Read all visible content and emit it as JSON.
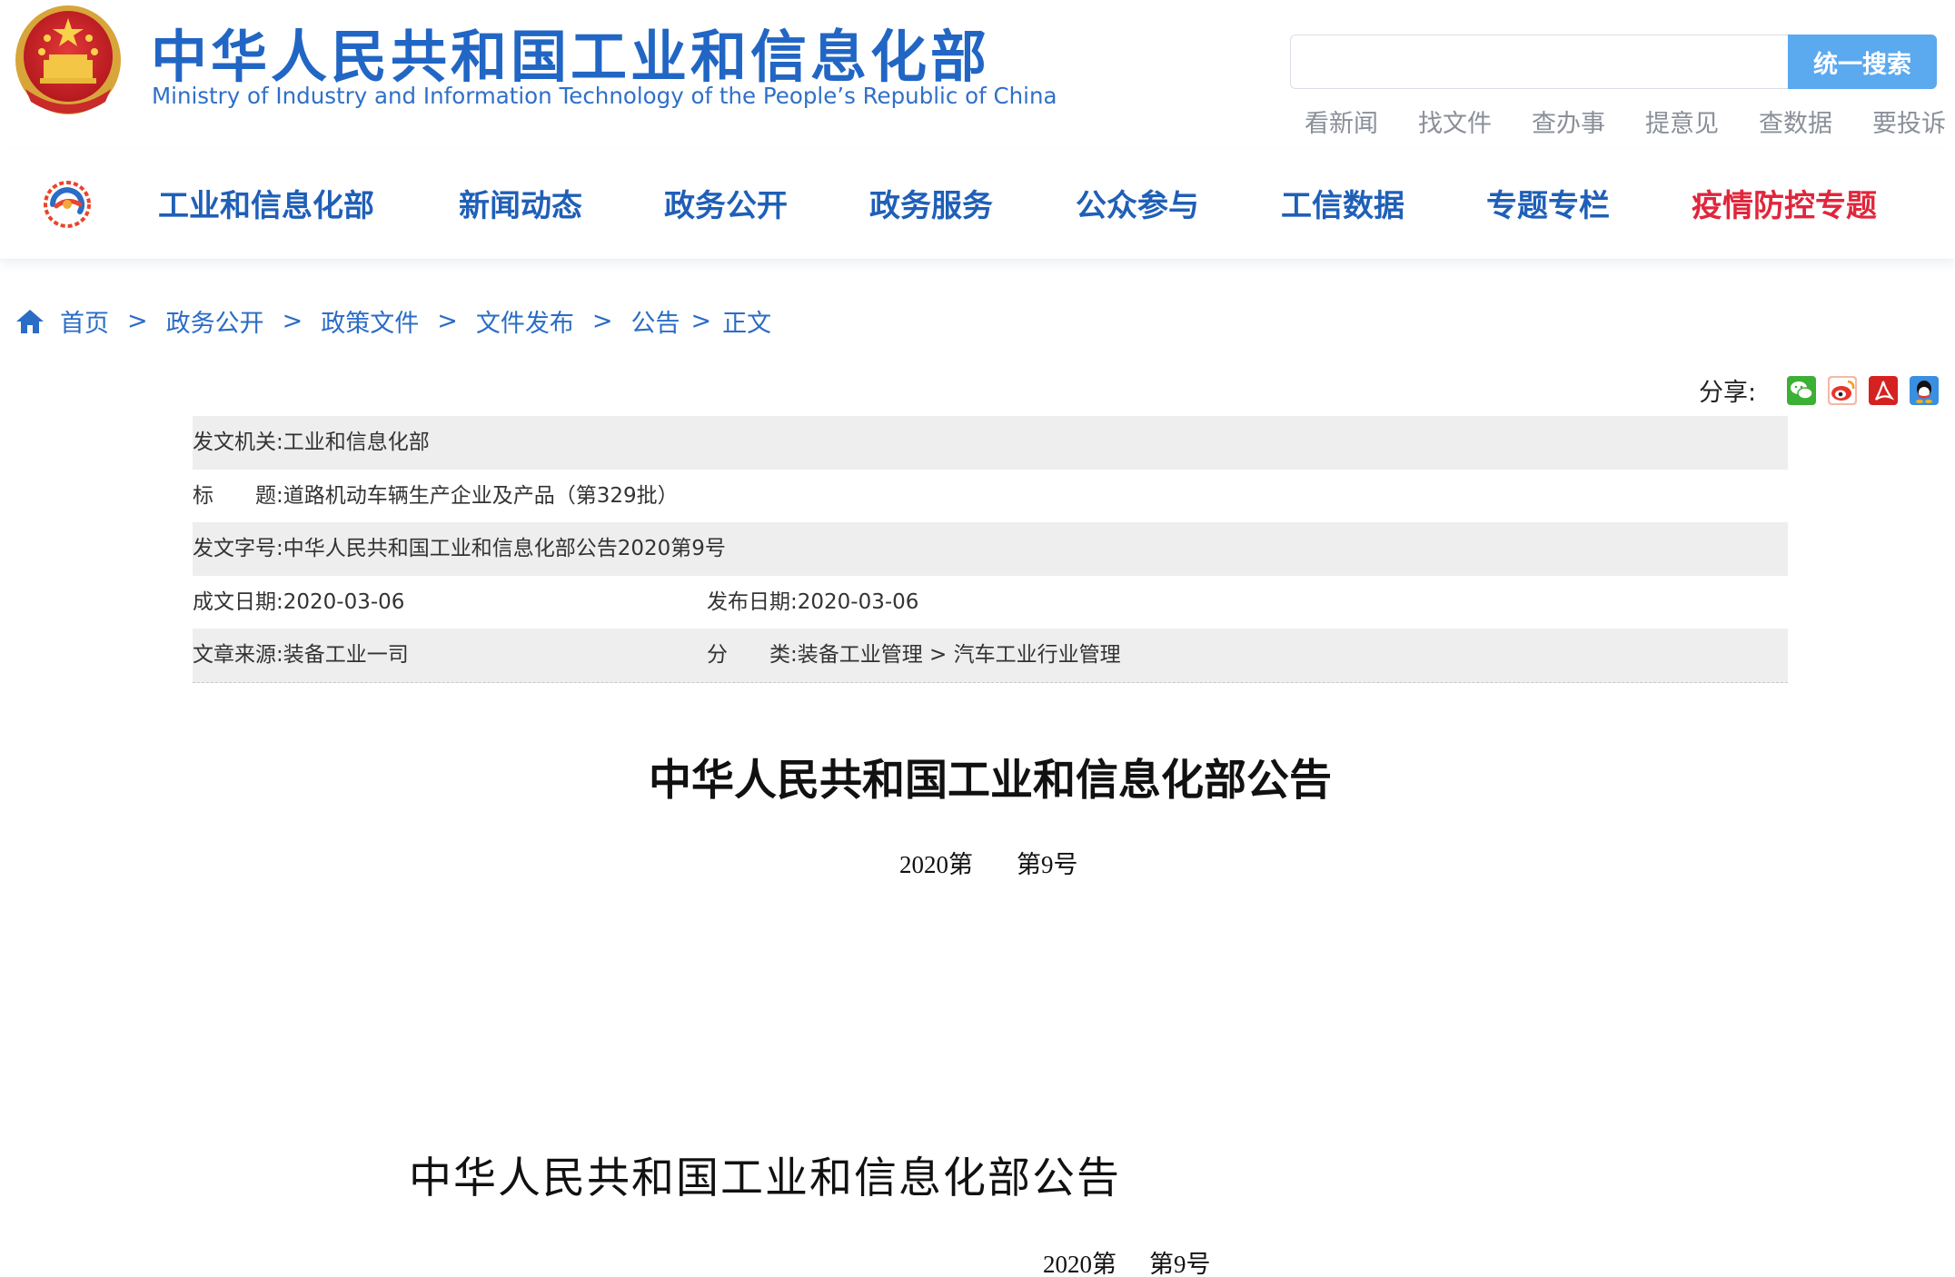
{
  "header": {
    "title_cn": "中华人民共和国工业和信息化部",
    "title_en": "Ministry of Industry and Information Technology of the People’s Republic of China",
    "search": {
      "value": "",
      "button_label": "统一搜索"
    },
    "quick_links": [
      "看新闻",
      "找文件",
      "查办事",
      "提意见",
      "查数据",
      "要投诉"
    ]
  },
  "nav": {
    "items": [
      {
        "label": "工业和信息化部"
      },
      {
        "label": "新闻动态"
      },
      {
        "label": "政务公开"
      },
      {
        "label": "政务服务"
      },
      {
        "label": "公众参与"
      },
      {
        "label": "工信数据"
      },
      {
        "label": "专题专栏"
      },
      {
        "label": "疫情防控专题"
      }
    ],
    "highlight_color": "#e0263c",
    "link_color": "#1f5fb7"
  },
  "breadcrumb": {
    "items": [
      "首页",
      "政务公开",
      "政策文件",
      "文件发布",
      "公告",
      "正文"
    ],
    "separator": ">"
  },
  "share": {
    "label": "分享:",
    "icons": [
      "wechat-icon",
      "weibo-icon",
      "pdf-icon",
      "qq-icon"
    ]
  },
  "meta": {
    "issuer_label": "发文机关:",
    "issuer": "工业和信息化部",
    "title_label": "标　　题:",
    "title": "道路机动车辆生产企业及产品（第329批）",
    "doc_no_label": "发文字号:",
    "doc_no": "中华人民共和国工业和信息化部公告2020第9号",
    "created_label": "成文日期:",
    "created": "2020-03-06",
    "published_label": "发布日期:",
    "published": "2020-03-06",
    "source_label": "文章来源:",
    "source": "装备工业一司",
    "category_label": "分　　类:",
    "category": "装备工业管理 > 汽车工业行业管理"
  },
  "body": {
    "heading": "中华人民共和国工业和信息化部公告",
    "number_year": "2020第",
    "number_no": "第9号",
    "heading2": "中华人民共和国工业和信息化部公告",
    "number2_year": "2020第",
    "number2_no": "第9号"
  }
}
